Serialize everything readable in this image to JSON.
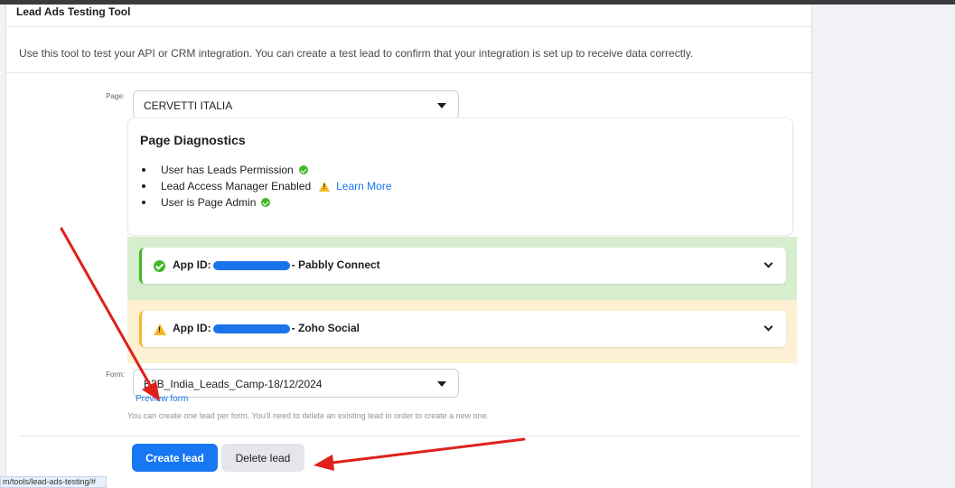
{
  "card": {
    "title": "Lead Ads Testing Tool",
    "description": "Use this tool to test your API or CRM integration. You can create a test lead to confirm that your integration is set up to receive data correctly."
  },
  "page_field": {
    "label": "Page:",
    "value": "CERVETTI ITALIA"
  },
  "diagnostics": {
    "title": "Page Diagnostics",
    "items": [
      {
        "text": "User has Leads Permission",
        "status_icon": "check-circle-icon"
      },
      {
        "text": "Lead Access Manager Enabled",
        "status_icon": "warning-icon",
        "link": "Learn More"
      },
      {
        "text": "User is Page Admin",
        "status_icon": "check-circle-icon"
      }
    ]
  },
  "apps": [
    {
      "prefix": "App ID:",
      "suffix": "- Pabbly Connect",
      "status": "success",
      "status_icon": "check-circle-icon"
    },
    {
      "prefix": "App ID:",
      "suffix": "- Zoho Social",
      "status": "warning",
      "status_icon": "warning-icon"
    }
  ],
  "form_field": {
    "label": "Form:",
    "value": "B2B_India_Leads_Camp-18/12/2024",
    "preview_link": "Preview form",
    "hint": "You can create one lead per form. You'll need to delete an existing lead in order to create a new one."
  },
  "buttons": {
    "create": "Create lead",
    "delete": "Delete lead"
  },
  "statusbar": {
    "url": "m/tools/lead-ads-testing/#"
  },
  "colors": {
    "primary": "#1877f2",
    "success": "#42b72a",
    "warning": "#f7b928",
    "annotation_arrow": "#e0201b"
  }
}
